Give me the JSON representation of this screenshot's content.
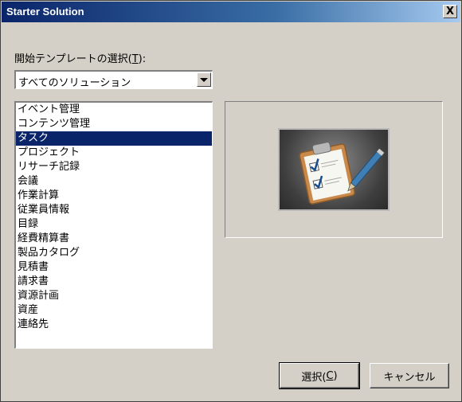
{
  "window": {
    "title": "Starter Solution",
    "close_glyph": "X"
  },
  "template_select": {
    "label_prefix": "開始テンプレートの選択(",
    "label_key": "T",
    "label_suffix": "):",
    "value": "すべてのソリューション"
  },
  "list": {
    "selected_index": 2,
    "items": [
      "イベント管理",
      "コンテンツ管理",
      "タスク",
      "プロジェクト",
      "リサーチ記録",
      "会議",
      "作業計算",
      "従業員情報",
      "目録",
      "経費精算書",
      "製品カタログ",
      "見積書",
      "請求書",
      "資源計画",
      "資産",
      "連絡先"
    ]
  },
  "buttons": {
    "ok_prefix": "選択(",
    "ok_key": "C",
    "ok_suffix": ")",
    "cancel": "キャンセル"
  },
  "icons": {
    "preview": "clipboard-checklist-icon"
  }
}
